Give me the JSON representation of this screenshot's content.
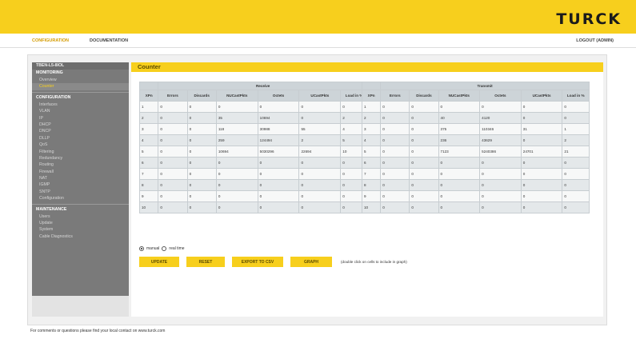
{
  "header": {
    "logo": "TURCK",
    "nav": {
      "configuration": "CONFIGURATION",
      "documentation": "DOCUMENTATION",
      "logout": "LOGOUT (ADMIN)"
    }
  },
  "sidebar": {
    "device": "TBEN-L5-8IOL",
    "monitoring_label": "MONITORING",
    "monitoring_items": [
      "Overview",
      "Counter"
    ],
    "active_item": "Counter",
    "configuration_label": "CONFIGURATION",
    "configuration_items": [
      "Interfaces",
      "VLAN",
      "IP",
      "DHCP",
      "DNCP",
      "DLLP",
      "QoS",
      "Filtering",
      "Redundancy",
      "Routing",
      "Firewall",
      "NAT",
      "IGMP",
      "SNTP",
      "Configuration"
    ],
    "maintenance_label": "MAINTENANCE",
    "maintenance_items": [
      "Users",
      "Update",
      "System",
      "Cable Diagnostics"
    ]
  },
  "page": {
    "title": "Counter"
  },
  "table": {
    "receive_label": "Receive",
    "transmit_label": "Transmit",
    "columns": [
      "XPn",
      "Errors",
      "Discards",
      "NUCastPkts",
      "Octets",
      "UCastPkts",
      "Load in %"
    ],
    "receive_rows": [
      [
        "1",
        "0",
        "0",
        "0",
        "0",
        "0",
        "0"
      ],
      [
        "2",
        "0",
        "0",
        "35",
        "10694",
        "0",
        "2"
      ],
      [
        "3",
        "0",
        "0",
        "118",
        "30988",
        "55",
        "4"
      ],
      [
        "4",
        "0",
        "0",
        "259",
        "124494",
        "2",
        "5"
      ],
      [
        "5",
        "0",
        "0",
        "10694",
        "5030296",
        "22694",
        "10"
      ],
      [
        "6",
        "0",
        "0",
        "0",
        "0",
        "0",
        "0"
      ],
      [
        "7",
        "0",
        "0",
        "0",
        "0",
        "0",
        "0"
      ],
      [
        "8",
        "0",
        "0",
        "0",
        "0",
        "0",
        "0"
      ],
      [
        "9",
        "0",
        "0",
        "0",
        "0",
        "0",
        "0"
      ],
      [
        "10",
        "0",
        "0",
        "0",
        "0",
        "0",
        "0"
      ]
    ],
    "transmit_rows": [
      [
        "1",
        "0",
        "0",
        "0",
        "0",
        "0",
        "0"
      ],
      [
        "2",
        "0",
        "0",
        "40",
        "4120",
        "0",
        "0"
      ],
      [
        "3",
        "0",
        "0",
        "375",
        "110346",
        "31",
        "1"
      ],
      [
        "4",
        "0",
        "0",
        "236",
        "43629",
        "0",
        "2"
      ],
      [
        "5",
        "0",
        "0",
        "7123",
        "5240386",
        "24701",
        "21"
      ],
      [
        "6",
        "0",
        "0",
        "0",
        "0",
        "0",
        "0"
      ],
      [
        "7",
        "0",
        "0",
        "0",
        "0",
        "0",
        "0"
      ],
      [
        "8",
        "0",
        "0",
        "0",
        "0",
        "0",
        "0"
      ],
      [
        "9",
        "0",
        "0",
        "0",
        "0",
        "0",
        "0"
      ],
      [
        "10",
        "0",
        "0",
        "0",
        "0",
        "0",
        "0"
      ]
    ]
  },
  "controls": {
    "manual_label": "manual",
    "realtime_label": "real time",
    "selected_mode": "manual",
    "buttons": {
      "update": "UPDATE",
      "reset": "RESET",
      "export": "EXPORT TO CSV",
      "graph": "GRAPH"
    },
    "hint": "(double click on cells to include in graph)"
  },
  "footer": {
    "note": "For comments or questions please find your local contact on www.turck.com"
  },
  "colors": {
    "brand_yellow": "#f7cf1d",
    "sidebar_gray": "#7a7a7a",
    "table_header": "#cdd4d8"
  }
}
